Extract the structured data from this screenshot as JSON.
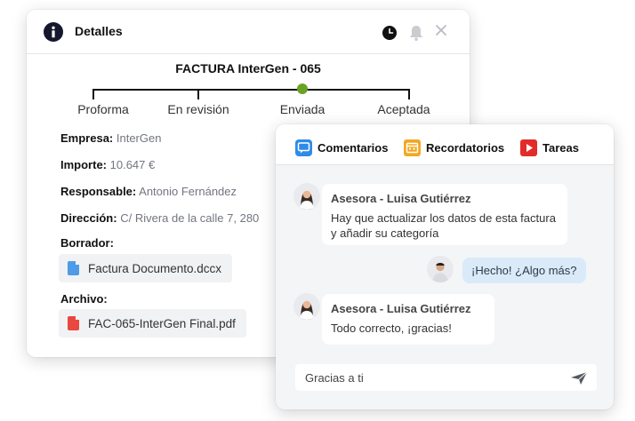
{
  "details": {
    "title": "Detalles",
    "invoice_title": "FACTURA InterGen - 065",
    "steps": [
      {
        "label": "Proforma"
      },
      {
        "label": "En revisión"
      },
      {
        "label": "Enviada",
        "current": true
      },
      {
        "label": "Aceptada"
      }
    ],
    "fields": [
      {
        "label": "Empresa:",
        "value": "InterGen"
      },
      {
        "label": "Importe:",
        "value": "10.647 €"
      },
      {
        "label": "Responsable:",
        "value": "Antonio Fernández"
      },
      {
        "label": "Dirección:",
        "value": "C/ Rivera de la calle 7, 280"
      }
    ],
    "draft_label": "Borrador:",
    "draft_file": "Factura Documento.dccx",
    "archive_label": "Archivo:",
    "archive_file": "FAC-065-InterGen Final.pdf",
    "icons": [
      "info-icon",
      "clock-icon",
      "bell-icon",
      "close-icon"
    ]
  },
  "chat": {
    "tabs": [
      {
        "label": "Comentarios",
        "icon": "comments-icon",
        "color": "#2f8be6"
      },
      {
        "label": "Recordatorios",
        "icon": "calendar-icon",
        "color": "#f2a823"
      },
      {
        "label": "Tareas",
        "icon": "tasks-icon",
        "color": "#e32b2b"
      }
    ],
    "messages": [
      {
        "author": "Asesora - Luisa Gutiérrez",
        "text": "Hay que actualizar los datos de esta factura y añadir su categoría"
      },
      {
        "text": "¡Hecho! ¿Algo más?"
      },
      {
        "author": "Asesora - Luisa Gutiérrez",
        "text": "Todo correcto, ¡gracias!"
      }
    ],
    "input_value": "Gracias a ti",
    "colors": {
      "accent_green": "#6aa224",
      "own_bubble": "#dbeaf9"
    }
  }
}
